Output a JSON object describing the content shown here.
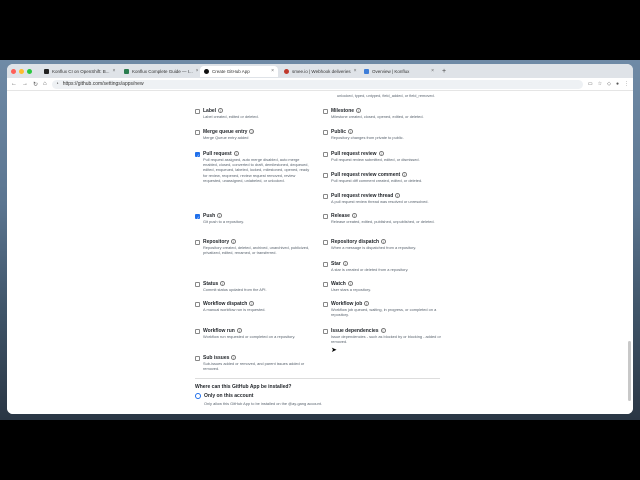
{
  "browser": {
    "tabs": [
      {
        "label": "Konflux CI on OpenShift: B..."
      },
      {
        "label": "Konflux Complete Guide — I..."
      },
      {
        "label": "Create GitHub App"
      },
      {
        "label": "smee.io | Webhook deliveries"
      },
      {
        "label": "Overview | Konflux"
      }
    ],
    "url": "https://github.com/settings/apps/new"
  },
  "events_top_right_desc": "unlocked, typed, untyped, field_added, or field_removed.",
  "events": [
    {
      "title": "Label",
      "desc": "Label created, edited or deleted.",
      "checked": false
    },
    {
      "title": "Milestone",
      "desc": "Milestone created, closed, opened, edited, or deleted.",
      "checked": false
    },
    {
      "title": "Merge queue entry",
      "desc": "Merge Queue entry added",
      "checked": false
    },
    {
      "title": "Public",
      "desc": "Repository changes from private to public.",
      "checked": false
    },
    {
      "title": "Pull request",
      "desc": "Pull request assigned, auto merge disabled, auto merge enabled, closed, converted to draft, demilestoned, dequeued, edited, enqueued, labeled, locked, milestoned, opened, ready for review, reopened, review request removed, review requested, unassigned, unlabeled, or unlocked.",
      "checked": true
    },
    {
      "title": "Pull request review",
      "desc": "Pull request review submitted, edited, or dismissed.",
      "checked": false
    },
    {
      "title": "Pull request review comment",
      "desc": "Pull request diff comment created, edited, or deleted.",
      "checked": false
    },
    {
      "title": "Pull request review thread",
      "desc": "A pull request review thread was resolved or unresolved.",
      "checked": false
    },
    {
      "title": "Push",
      "desc": "Git push to a repository.",
      "checked": true
    },
    {
      "title": "Release",
      "desc": "Release created, edited, published, unpublished, or deleted.",
      "checked": false
    },
    {
      "title": "Repository",
      "desc": "Repository created, deleted, archived, unarchived, publicized, privatized, edited, renamed, or transferred.",
      "checked": false
    },
    {
      "title": "Repository dispatch",
      "desc": "When a message is dispatched from a repository.",
      "checked": false
    },
    {
      "title": "Star",
      "desc": "A star is created or deleted from a repository.",
      "checked": false
    },
    {
      "title": "Status",
      "desc": "Commit status updated from the API.",
      "checked": false
    },
    {
      "title": "Watch",
      "desc": "User stars a repository.",
      "checked": false
    },
    {
      "title": "Workflow dispatch",
      "desc": "A manual workflow run is requested.",
      "checked": false
    },
    {
      "title": "Workflow job",
      "desc": "Workflow job queued, waiting, in progress, or completed on a repository.",
      "checked": false
    },
    {
      "title": "Workflow run",
      "desc": "Workflow run requested or completed on a repository.",
      "checked": false
    },
    {
      "title": "Issue dependencies",
      "desc": "Issue dependencies - such as blocked by or blocking - added or removed.",
      "checked": false
    },
    {
      "title": "Sub issues",
      "desc": "Sub-issues added or removed, and parent issues added or removed.",
      "checked": false
    }
  ],
  "install": {
    "question": "Where can this GitHub App be installed?",
    "option_label": "Only on this account",
    "option_desc": "Only allow this GitHub App to be installed on the @ay-gang account."
  }
}
